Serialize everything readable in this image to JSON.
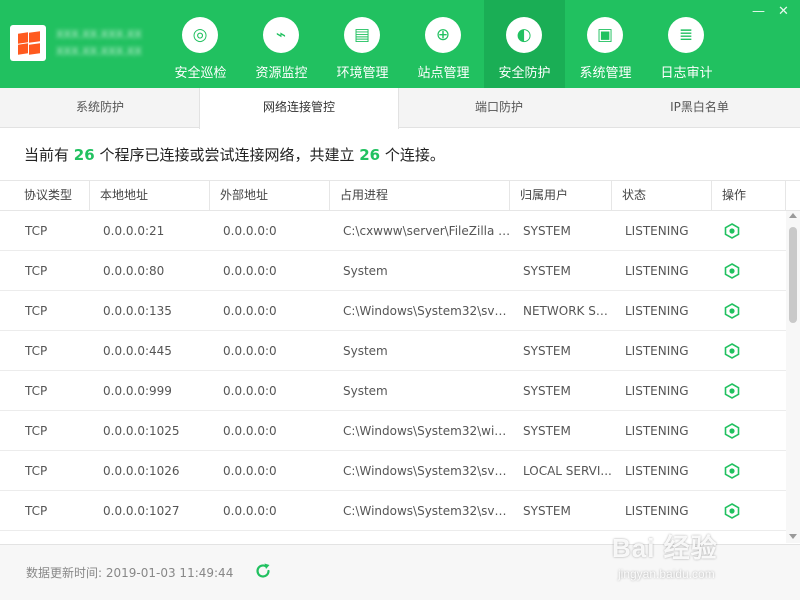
{
  "header": {
    "server_info_line1": "XXX.XX.XXX.XX",
    "server_info_line2": "XXX.XX.XXX.XX"
  },
  "nav": [
    {
      "label": "安全巡检",
      "icon": "radar-scan-icon",
      "glyph": "◎",
      "active": false
    },
    {
      "label": "资源监控",
      "icon": "monitor-chart-icon",
      "glyph": "⌁",
      "active": false
    },
    {
      "label": "环境管理",
      "icon": "server-stack-icon",
      "glyph": "▤",
      "active": false
    },
    {
      "label": "站点管理",
      "icon": "globe-icon",
      "glyph": "⊕",
      "active": false
    },
    {
      "label": "安全防护",
      "icon": "shield-icon",
      "glyph": "◐",
      "active": true
    },
    {
      "label": "系统管理",
      "icon": "system-monitor-icon",
      "glyph": "▣",
      "active": false
    },
    {
      "label": "日志审计",
      "icon": "document-icon",
      "glyph": "≣",
      "active": false
    }
  ],
  "window_controls": {
    "minimize": "—",
    "close": "✕"
  },
  "tabs": [
    {
      "label": "系统防护",
      "active": false
    },
    {
      "label": "网络连接管控",
      "active": true
    },
    {
      "label": "端口防护",
      "active": false
    },
    {
      "label": "IP黑白名单",
      "active": false
    }
  ],
  "summary": {
    "prefix": "当前有",
    "program_count": "26",
    "middle": "个程序已连接或尝试连接网络，共建立",
    "connection_count": "26",
    "suffix": "个连接。"
  },
  "table": {
    "columns": [
      "协议类型",
      "本地地址",
      "外部地址",
      "占用进程",
      "归属用户",
      "状态",
      "操作"
    ],
    "rows": [
      {
        "protocol": "TCP",
        "local": "0.0.0.0:21",
        "remote": "0.0.0.0:0",
        "process": "C:\\cxwww\\server\\FileZilla S...",
        "user": "SYSTEM",
        "state": "LISTENING"
      },
      {
        "protocol": "TCP",
        "local": "0.0.0.0:80",
        "remote": "0.0.0.0:0",
        "process": "System",
        "user": "SYSTEM",
        "state": "LISTENING"
      },
      {
        "protocol": "TCP",
        "local": "0.0.0.0:135",
        "remote": "0.0.0.0:0",
        "process": "C:\\Windows\\System32\\svch...",
        "user": "NETWORK SE...",
        "state": "LISTENING"
      },
      {
        "protocol": "TCP",
        "local": "0.0.0.0:445",
        "remote": "0.0.0.0:0",
        "process": "System",
        "user": "SYSTEM",
        "state": "LISTENING"
      },
      {
        "protocol": "TCP",
        "local": "0.0.0.0:999",
        "remote": "0.0.0.0:0",
        "process": "System",
        "user": "SYSTEM",
        "state": "LISTENING"
      },
      {
        "protocol": "TCP",
        "local": "0.0.0.0:1025",
        "remote": "0.0.0.0:0",
        "process": "C:\\Windows\\System32\\wini...",
        "user": "SYSTEM",
        "state": "LISTENING"
      },
      {
        "protocol": "TCP",
        "local": "0.0.0.0:1026",
        "remote": "0.0.0.0:0",
        "process": "C:\\Windows\\System32\\svch...",
        "user": "LOCAL SERVI...",
        "state": "LISTENING"
      },
      {
        "protocol": "TCP",
        "local": "0.0.0.0:1027",
        "remote": "0.0.0.0:0",
        "process": "C:\\Windows\\System32\\svch...",
        "user": "SYSTEM",
        "state": "LISTENING"
      }
    ]
  },
  "footer": {
    "update_label": "数据更新时间:",
    "update_time": "2019-01-03 11:49:44"
  },
  "watermark": {
    "line1": "Bai 经验",
    "line2": "jingyan.baidu.com"
  },
  "colors": {
    "brand": "#21c160",
    "brand_active": "#1aae55"
  }
}
